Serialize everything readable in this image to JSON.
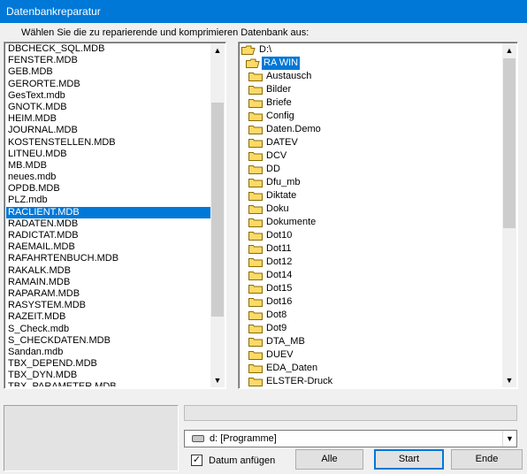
{
  "window": {
    "title": "Datenbankreparatur"
  },
  "prompt": "Wählen Sie die zu reparierende und komprimieren Datenbank aus:",
  "files": {
    "items": [
      "DBCHECK_SQL.MDB",
      "FENSTER.MDB",
      "GEB.MDB",
      "GERORTE.MDB",
      "GesText.mdb",
      "GNOTK.MDB",
      "HEIM.MDB",
      "JOURNAL.MDB",
      "KOSTENSTELLEN.MDB",
      "LITNEU.MDB",
      "MB.MDB",
      "neues.mdb",
      "OPDB.MDB",
      "PLZ.mdb",
      "RACLIENT.MDB",
      "RADATEN.MDB",
      "RADICTAT.MDB",
      "RAEMAIL.MDB",
      "RAFAHRTENBUCH.MDB",
      "RAKALK.MDB",
      "RAMAIN.MDB",
      "RAPARAM.MDB",
      "RASYSTEM.MDB",
      "RAZEIT.MDB",
      "S_Check.mdb",
      "S_CHECKDATEN.MDB",
      "Sandan.mdb",
      "TBX_DEPEND.MDB",
      "TBX_DYN.MDB",
      "TBX_PARAMETER.MDB"
    ],
    "selected_index": 14
  },
  "dirs": {
    "root": "D:\\",
    "current": "RA WIN",
    "items": [
      "Austausch",
      "Bilder",
      "Briefe",
      "Config",
      "Daten.Demo",
      "DATEV",
      "DCV",
      "DD",
      "Dfu_mb",
      "Diktate",
      "Doku",
      "Dokumente",
      "Dot10",
      "Dot11",
      "Dot12",
      "Dot14",
      "Dot15",
      "Dot16",
      "Dot8",
      "Dot9",
      "DTA_MB",
      "DUEV",
      "EDA_Daten",
      "ELSTER-Druck"
    ]
  },
  "drive": {
    "value": "d: [Programme]"
  },
  "append_date": {
    "label": "Datum anfügen",
    "checked": true,
    "mark": "✓"
  },
  "buttons": {
    "all": "Alle",
    "start": "Start",
    "end": "Ende"
  },
  "glyphs": {
    "up": "▲",
    "down": "▼",
    "combo_down": "▼"
  },
  "colors": {
    "title_bar": "#0078d7",
    "selection": "#0078d7",
    "folder": "#ffd966"
  }
}
